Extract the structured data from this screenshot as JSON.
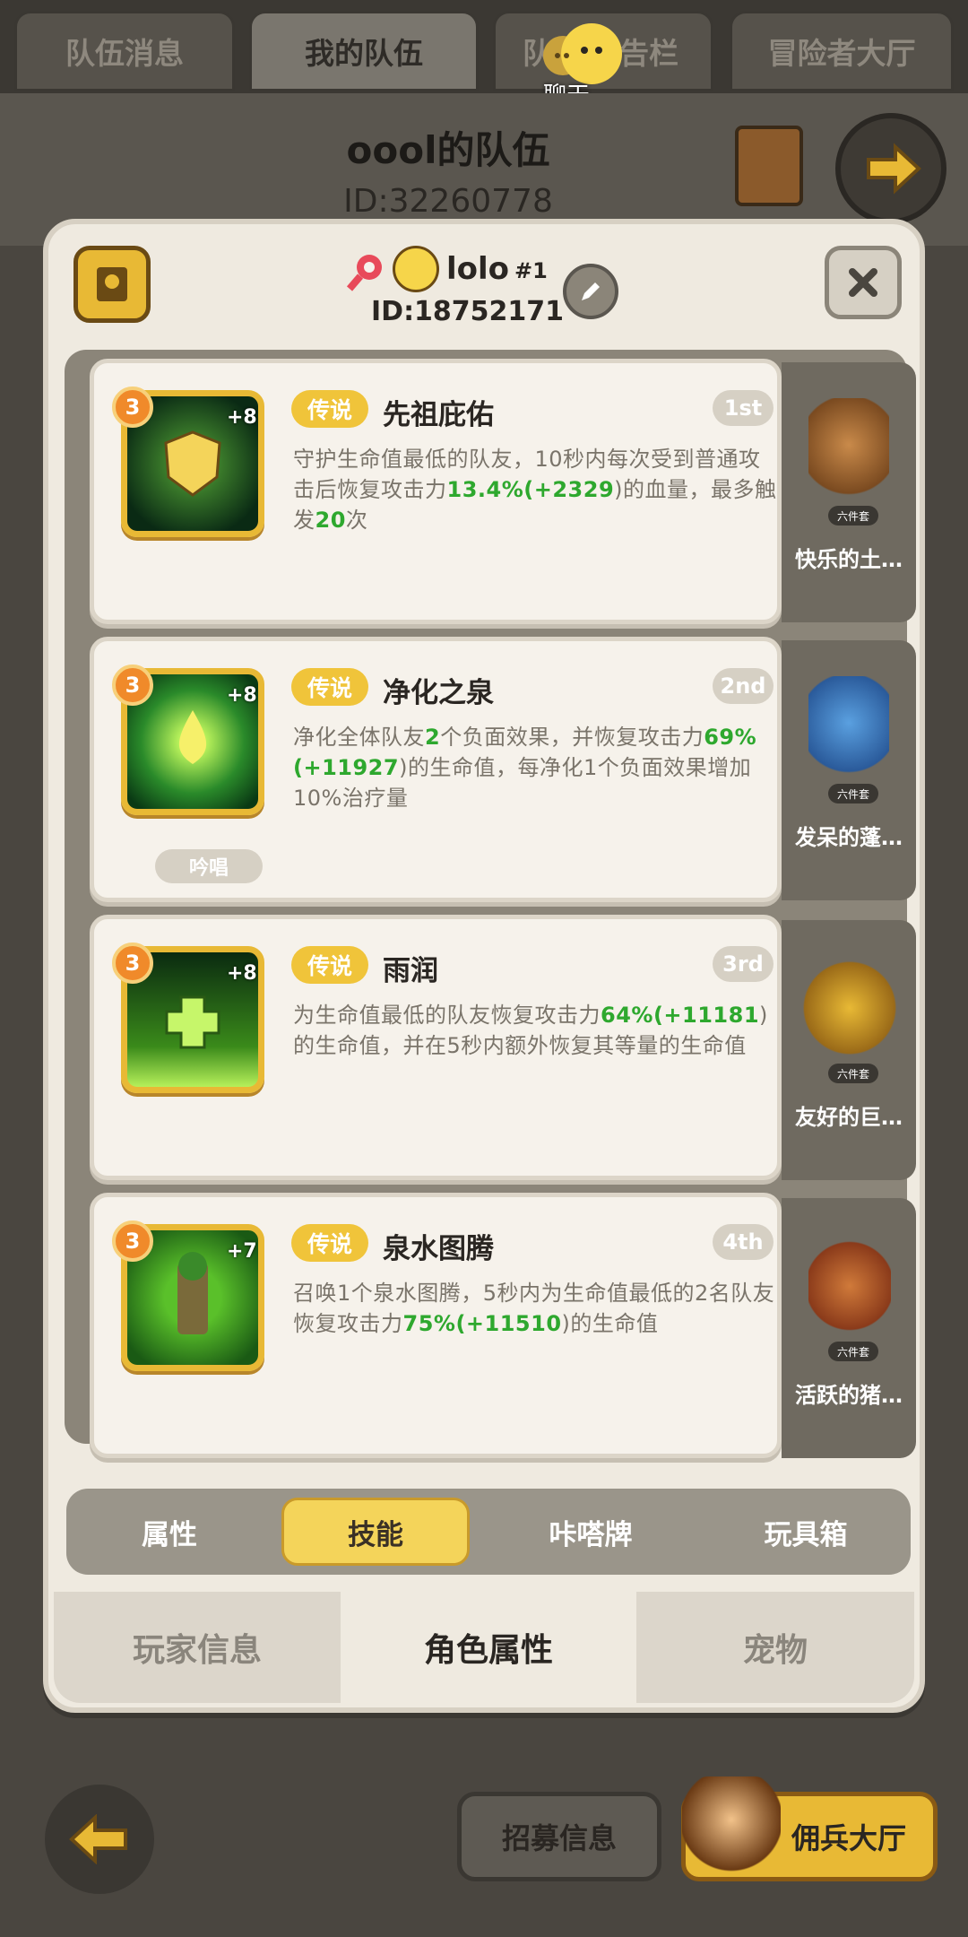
{
  "top_tabs": [
    "队伍消息",
    "我的队伍",
    "队伍公告栏",
    "冒险者大厅"
  ],
  "top_tab_visible": {
    "tab3_left": "队",
    "tab3_right": "告栏"
  },
  "chat_label": "聊天",
  "team": {
    "name": "oool的队伍",
    "id": "ID:32260778"
  },
  "player": {
    "name": "lolo",
    "rank_tag": "#1",
    "id": "ID:18752171"
  },
  "skills": [
    {
      "level": "3",
      "plus": "+8",
      "rarity": "传说",
      "name": "先祖庇佑",
      "rank": "1st",
      "desc_parts": [
        "守护生命值最低的队友，10秒内每次受到普通攻击后恢复攻击力",
        "13.4%",
        "(+",
        "2329",
        ")的血量，最多触发",
        "20",
        "次"
      ],
      "set_name": "快乐的土…",
      "set_badge": "六件套",
      "chant": ""
    },
    {
      "level": "3",
      "plus": "+8",
      "rarity": "传说",
      "name": "净化之泉",
      "rank": "2nd",
      "desc_parts": [
        "净化全体队友",
        "2",
        "个负面效果，并恢复攻击力",
        "69%",
        "(+",
        "11927",
        ")的生命值，每净化1个负面效果增加10%治疗量"
      ],
      "set_name": "发呆的蓬…",
      "set_badge": "六件套",
      "chant": "吟唱"
    },
    {
      "level": "3",
      "plus": "+8",
      "rarity": "传说",
      "name": "雨润",
      "rank": "3rd",
      "desc_parts": [
        "为生命值最低的队友恢复攻击力",
        "64%",
        "(+",
        "11181",
        ")的生命值，并在5秒内额外恢复其等量的生命值"
      ],
      "set_name": "友好的巨…",
      "set_badge": "六件套",
      "chant": ""
    },
    {
      "level": "3",
      "plus": "+7",
      "rarity": "传说",
      "name": "泉水图腾",
      "rank": "4th",
      "desc_parts": [
        "召唤1个泉水图腾，5秒内为生命值最低的2名队友恢复攻击力",
        "75%",
        "(+",
        "11510",
        ")的生命值"
      ],
      "set_name": "活跃的猪…",
      "set_badge": "六件套",
      "chant": ""
    }
  ],
  "segments": [
    "属性",
    "技能",
    "咔嗒牌",
    "玩具箱"
  ],
  "bottom_tabs": [
    "玩家信息",
    "角色属性",
    "宠物"
  ],
  "footer": {
    "recruit": "招募信息",
    "hall": "佣兵大厅"
  }
}
